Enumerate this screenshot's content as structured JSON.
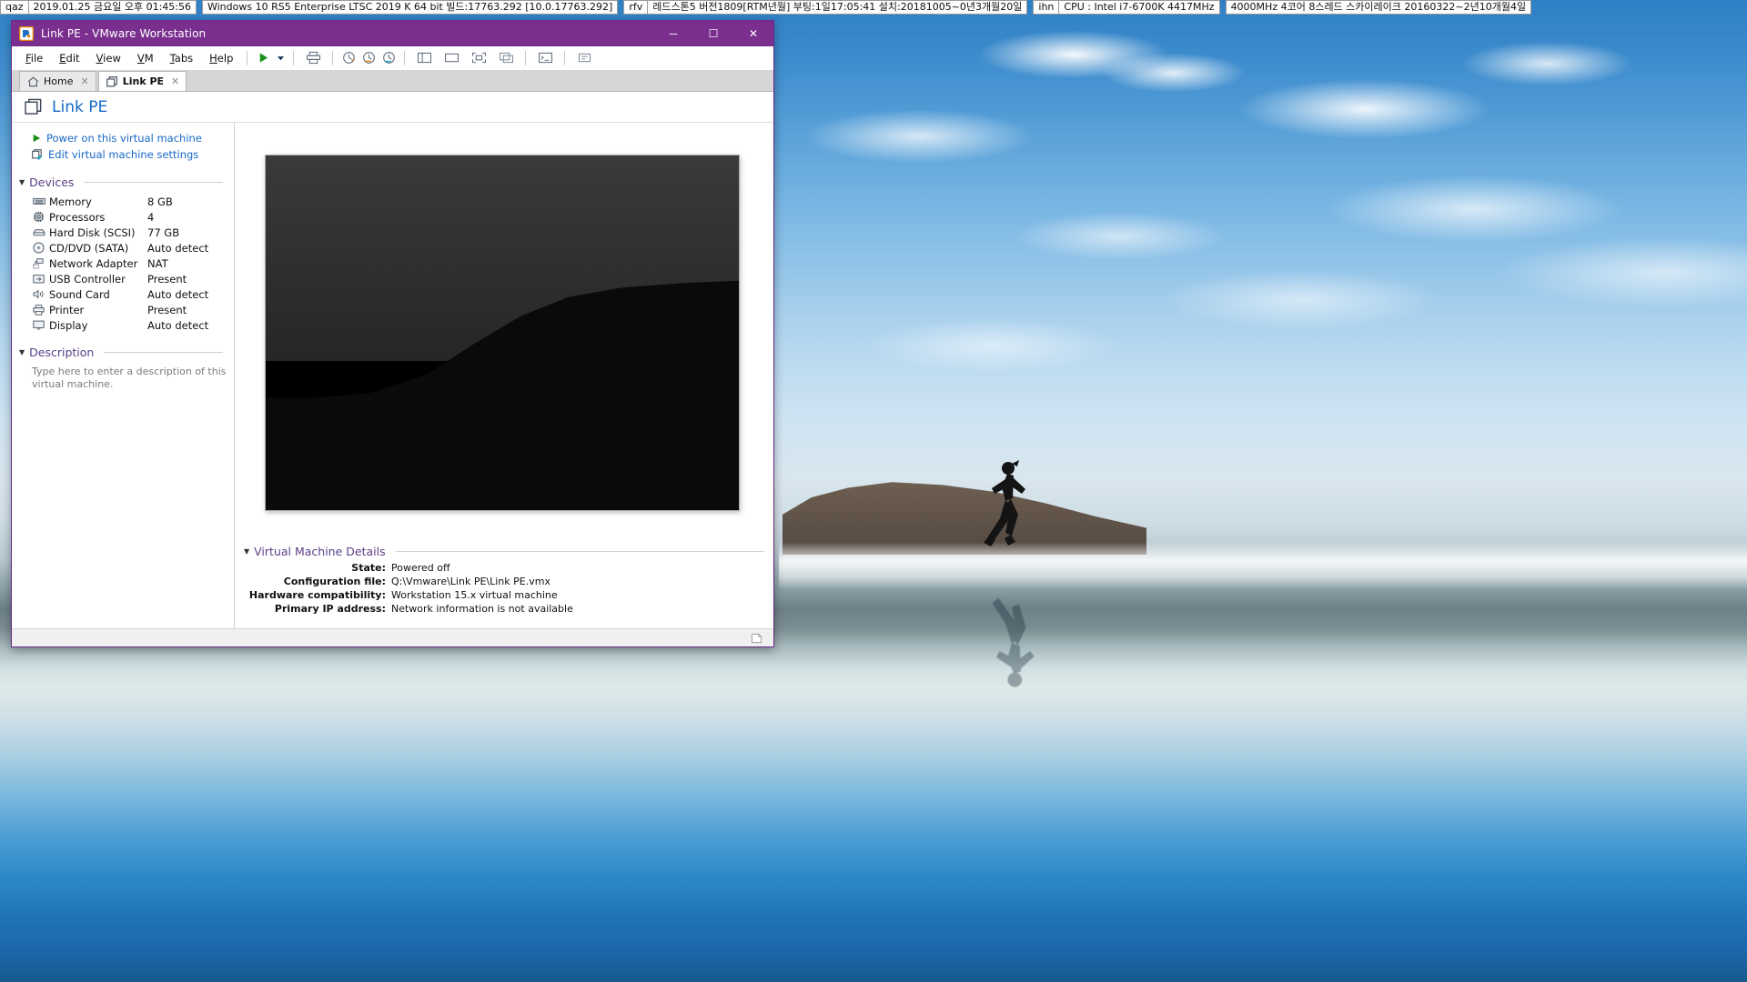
{
  "topbar": {
    "windows": [
      {
        "tag": "qaz",
        "title": "2019.01.25 금요일 오후 01:45:56"
      },
      {
        "tag": "",
        "title": "Windows 10 RS5 Enterprise LTSC 2019 K 64 bit 빌드:17763.292 [10.0.17763.292]"
      },
      {
        "tag": "rfv",
        "title": "레드스톤5 버전1809[RTM년월] 부팅:1일17:05:41 설치:20181005~0년3개월20일"
      },
      {
        "tag": "ihn",
        "title": "CPU : Intel i7-6700K 4417MHz"
      },
      {
        "tag": "",
        "title": "4000MHz 4코어 8스레드 스카이레이크 20160322~2년10개월4일"
      }
    ]
  },
  "window": {
    "title": "Link PE - VMware Workstation",
    "icon_name": "vmware-app-icon",
    "minimize_label": "─",
    "maximize_label": "☐",
    "close_label": "✕",
    "accent_color": "#7a2f8f"
  },
  "menubar": {
    "items": [
      {
        "label": "File",
        "mnemonic": "F"
      },
      {
        "label": "Edit",
        "mnemonic": "E"
      },
      {
        "label": "View",
        "mnemonic": "V"
      },
      {
        "label": "VM",
        "mnemonic": "V"
      },
      {
        "label": "Tabs",
        "mnemonic": "T"
      },
      {
        "label": "Help",
        "mnemonic": "H"
      }
    ],
    "toolbar_icons": [
      "power-on-icon",
      "power-dropdown-icon",
      "manage-snapshots-icon",
      "take-snapshot-icon",
      "revert-snapshot-icon",
      "snapshot-manager-icon",
      "show-library-icon",
      "show-thumbnail-bar-icon",
      "full-screen-icon",
      "unity-mode-icon",
      "console-view-icon",
      "send-ctrl-alt-del-icon"
    ]
  },
  "tabs": [
    {
      "label": "Home",
      "icon": "home-icon",
      "active": false,
      "closable": true
    },
    {
      "label": "Link PE",
      "icon": "vm-icon",
      "active": true,
      "closable": true
    }
  ],
  "vm": {
    "name": "Link PE",
    "title_color": "#1769c6",
    "actions": [
      {
        "label": "Power on this virtual machine",
        "icon": "play-triangle-icon"
      },
      {
        "label": "Edit virtual machine settings",
        "icon": "edit-settings-icon"
      }
    ],
    "devices_section": {
      "title": "Devices",
      "collapse_glyph": "▼",
      "rows": [
        {
          "icon": "memory-icon",
          "name": "Memory",
          "value": "8 GB"
        },
        {
          "icon": "cpu-icon",
          "name": "Processors",
          "value": "4"
        },
        {
          "icon": "harddisk-icon",
          "name": "Hard Disk (SCSI)",
          "value": "77 GB"
        },
        {
          "icon": "cddvd-icon",
          "name": "CD/DVD (SATA)",
          "value": "Auto detect"
        },
        {
          "icon": "network-icon",
          "name": "Network Adapter",
          "value": "NAT"
        },
        {
          "icon": "usb-icon",
          "name": "USB Controller",
          "value": "Present"
        },
        {
          "icon": "sound-icon",
          "name": "Sound Card",
          "value": "Auto detect"
        },
        {
          "icon": "printer-icon",
          "name": "Printer",
          "value": "Present"
        },
        {
          "icon": "display-icon",
          "name": "Display",
          "value": "Auto detect"
        }
      ]
    },
    "description_section": {
      "title": "Description",
      "collapse_glyph": "▼",
      "placeholder": "Type here to enter a description of this virtual machine."
    },
    "details_section": {
      "title": "Virtual Machine Details",
      "collapse_glyph": "▼",
      "rows": [
        {
          "label": "State:",
          "value": "Powered off"
        },
        {
          "label": "Configuration file:",
          "value": "Q:\\Vmware\\Link PE\\Link PE.vmx"
        },
        {
          "label": "Hardware compatibility:",
          "value": "Workstation 15.x virtual machine"
        },
        {
          "label": "Primary IP address:",
          "value": "Network information is not available"
        }
      ]
    }
  },
  "statusbar": {
    "icon": "resize-grip-icon"
  }
}
